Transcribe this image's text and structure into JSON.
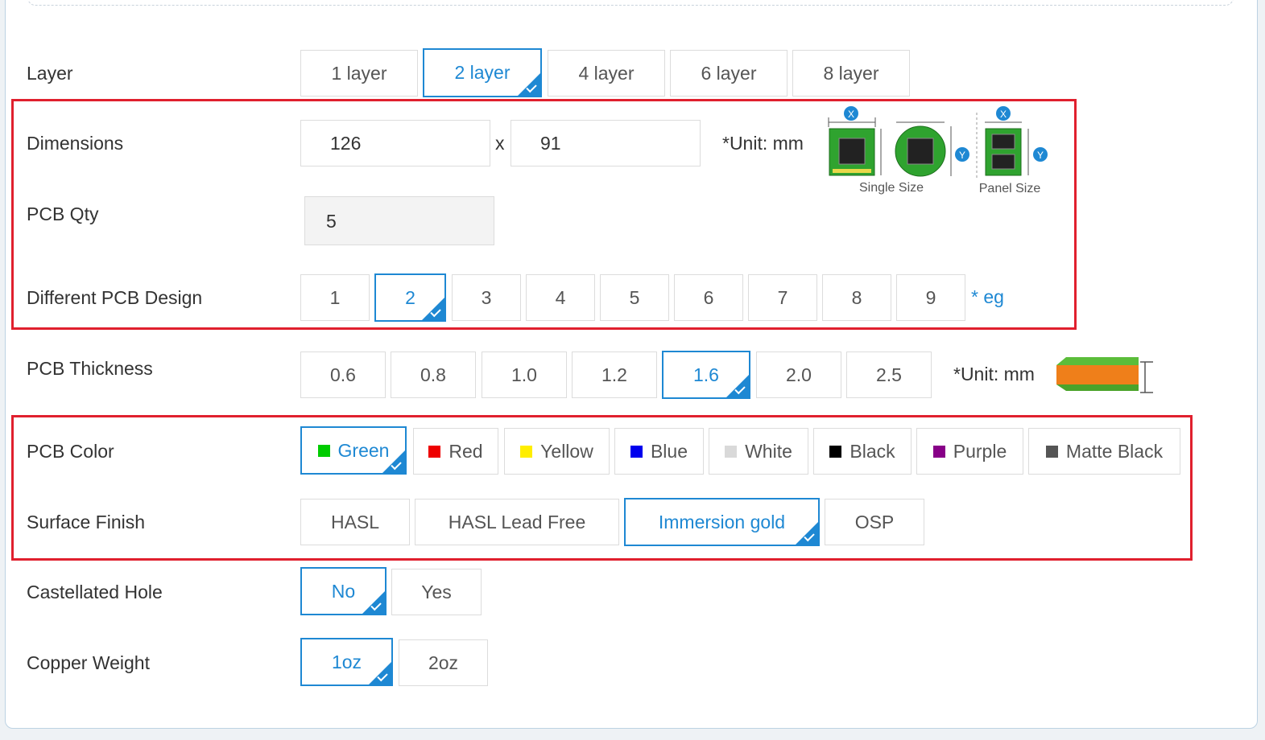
{
  "rows": {
    "layer": {
      "label": "Layer",
      "options": [
        "1 layer",
        "2 layer",
        "4 layer",
        "6 layer",
        "8 layer"
      ],
      "selected": "2 layer"
    },
    "dimensions": {
      "label": "Dimensions",
      "x_value": "126",
      "y_value": "91",
      "separator": "x",
      "unit": "*Unit: mm",
      "diagram": {
        "single_caption": "Single Size",
        "panel_caption": "Panel Size",
        "x_marker": "X",
        "y_marker": "Y"
      }
    },
    "qty": {
      "label": "PCB Qty",
      "value": "5"
    },
    "design": {
      "label": "Different PCB Design",
      "options": [
        "1",
        "2",
        "3",
        "4",
        "5",
        "6",
        "7",
        "8",
        "9"
      ],
      "selected": "2",
      "link": "* eg"
    },
    "thickness": {
      "label": "PCB Thickness",
      "options": [
        "0.6",
        "0.8",
        "1.0",
        "1.2",
        "1.6",
        "2.0",
        "2.5"
      ],
      "selected": "1.6",
      "unit": "*Unit: mm"
    },
    "color": {
      "label": "PCB Color",
      "options": [
        {
          "name": "Green",
          "color": "#00cc00"
        },
        {
          "name": "Red",
          "color": "#ee0000"
        },
        {
          "name": "Yellow",
          "color": "#ffee00"
        },
        {
          "name": "Blue",
          "color": "#0000ee"
        },
        {
          "name": "White",
          "color": "#d9d9d9"
        },
        {
          "name": "Black",
          "color": "#000000"
        },
        {
          "name": "Purple",
          "color": "#880088"
        },
        {
          "name": "Matte Black",
          "color": "#555555"
        }
      ],
      "selected": "Green"
    },
    "finish": {
      "label": "Surface Finish",
      "options": [
        "HASL",
        "HASL Lead Free",
        "Immersion gold",
        "OSP"
      ],
      "selected": "Immersion gold"
    },
    "castellated": {
      "label": "Castellated Hole",
      "options": [
        "No",
        "Yes"
      ],
      "selected": "No"
    },
    "copper": {
      "label": "Copper Weight",
      "options": [
        "1oz",
        "2oz"
      ],
      "selected": "1oz"
    }
  },
  "theme": {
    "accent": "#1e88d3",
    "highlight_border": "#e0202e"
  }
}
